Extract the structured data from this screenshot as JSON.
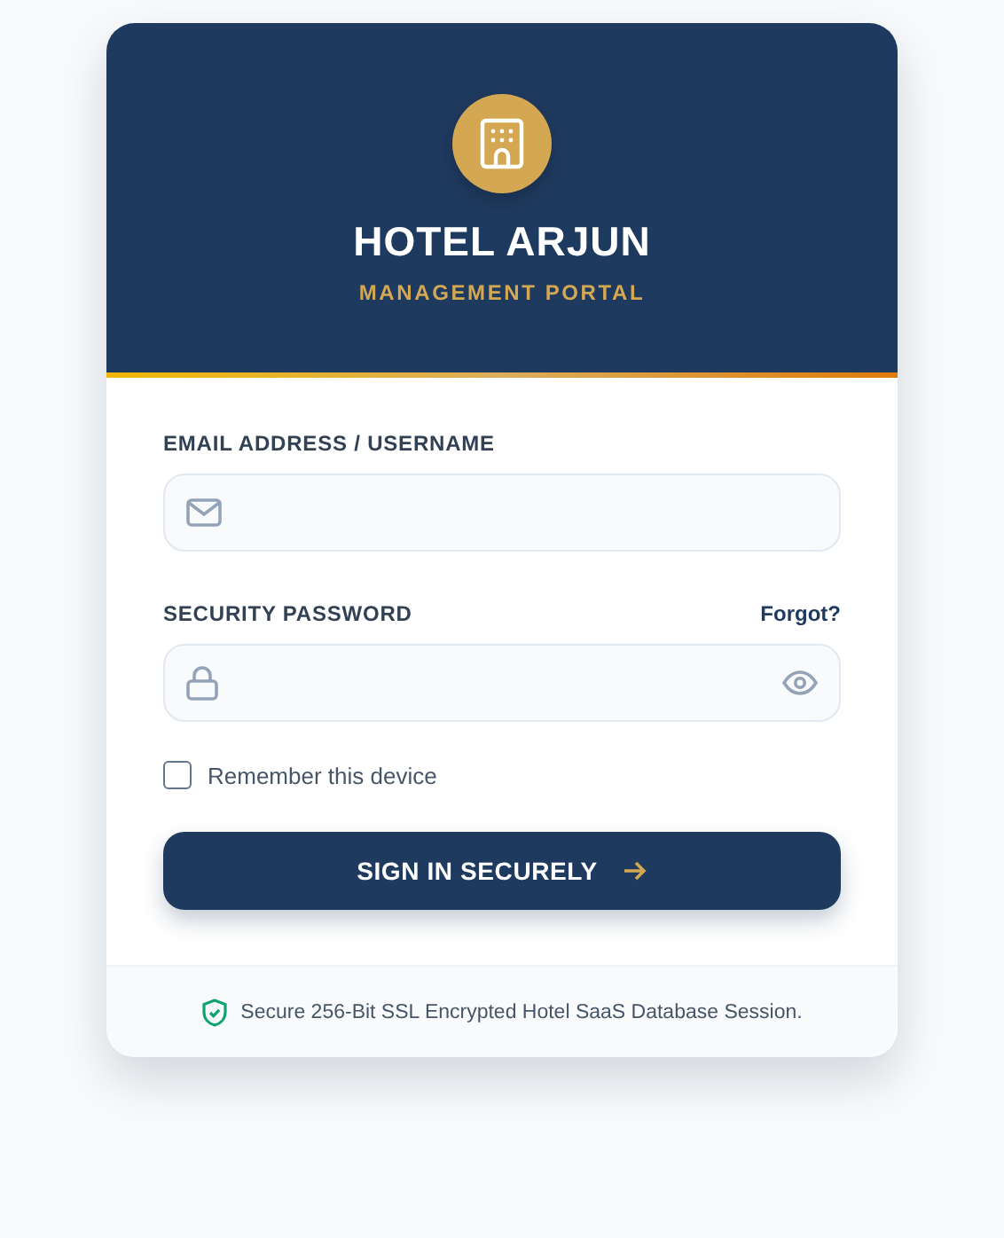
{
  "brand": {
    "title": "HOTEL ARJUN",
    "subtitle": "MANAGEMENT PORTAL"
  },
  "fields": [
    {
      "kind": "email",
      "label": "EMAIL ADDRESS / USERNAME"
    },
    {
      "kind": "password",
      "label": "SECURITY PASSWORD",
      "link": "Forgot?"
    }
  ],
  "remember": {
    "label": "Remember this device",
    "checked": false
  },
  "submit": {
    "label": "SIGN IN SECURELY"
  },
  "footer": {
    "text": "Secure 256-Bit SSL Encrypted Hotel SaaS Database Session."
  }
}
